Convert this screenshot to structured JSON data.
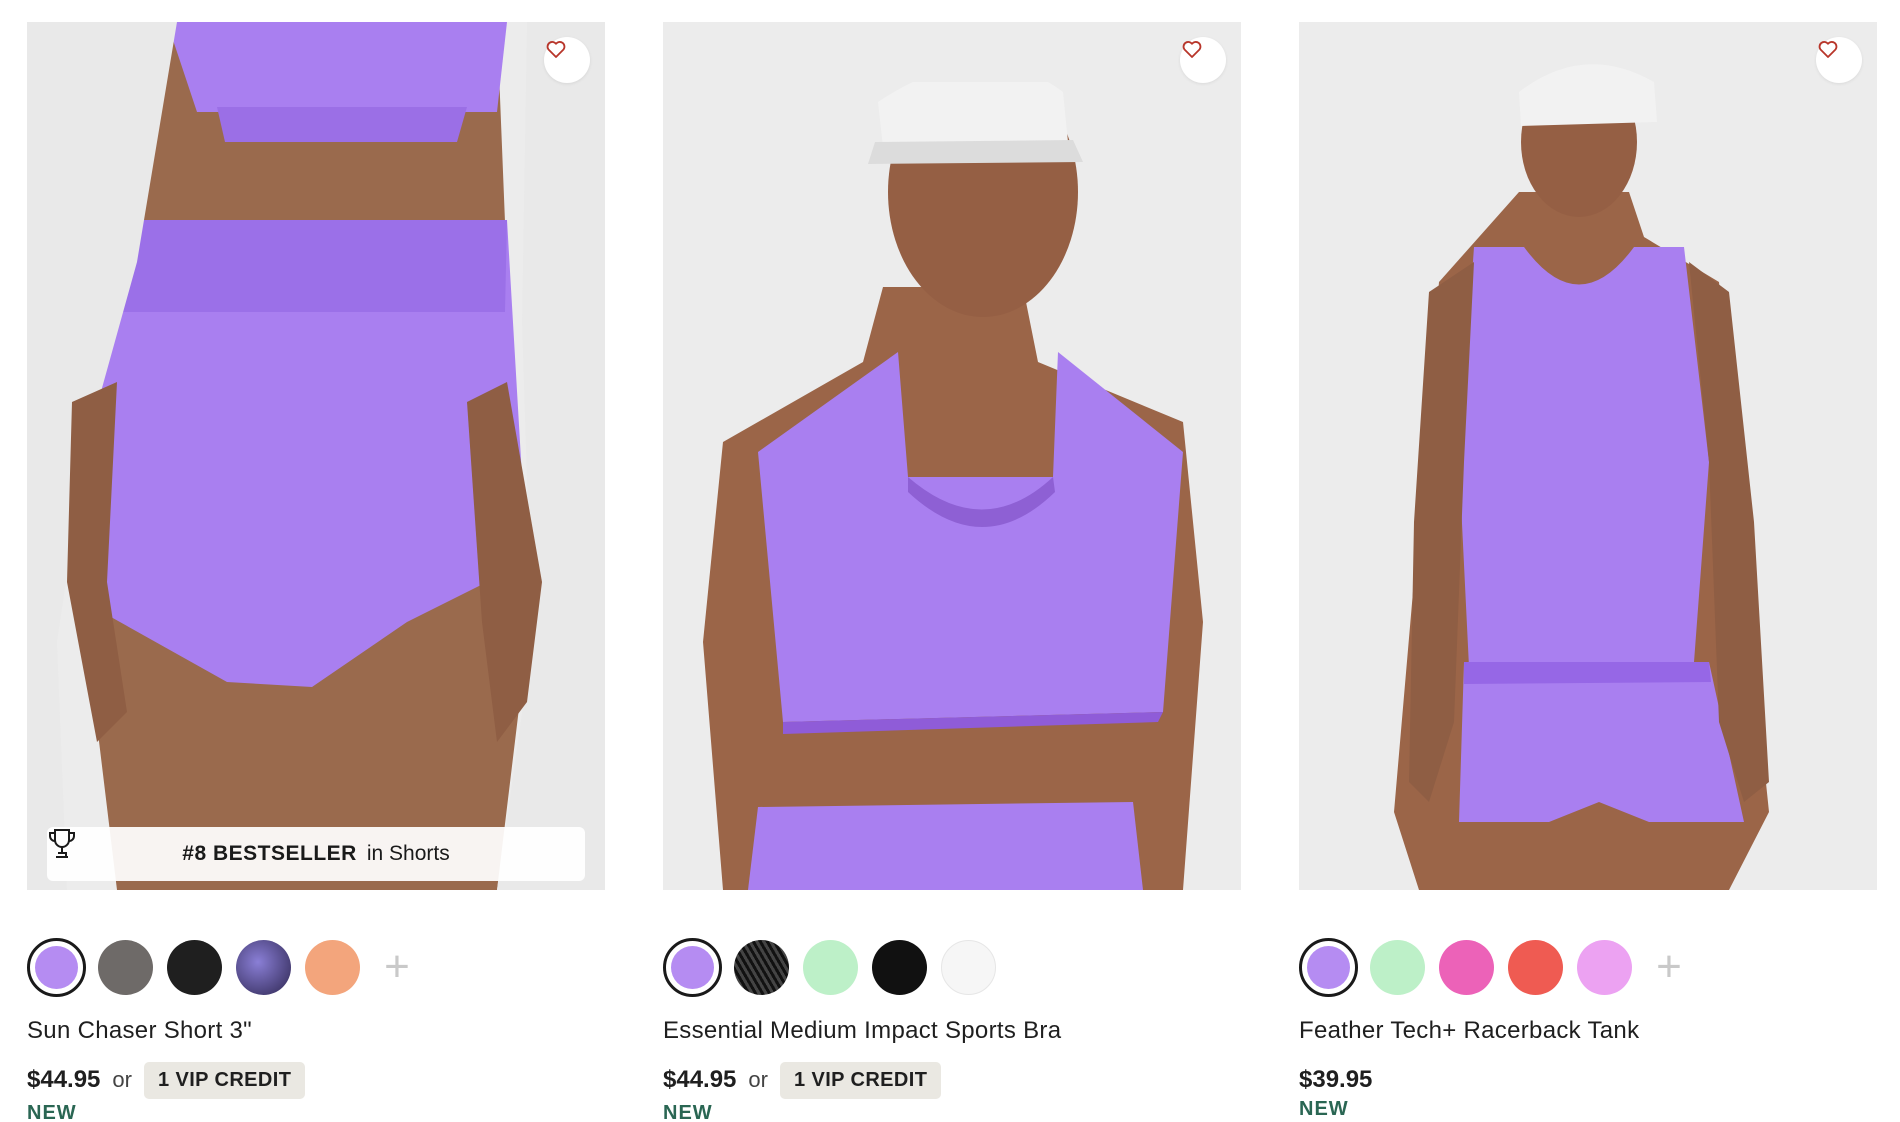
{
  "products": [
    {
      "name": "Sun Chaser Short 3\"",
      "price": "$44.95",
      "or_text": "or",
      "credit_label": "1 VIP CREDIT",
      "new_label": "NEW",
      "badge": {
        "rank": "#8 BESTSELLER",
        "suffix": "in Shorts"
      },
      "swatches": [
        {
          "color": "#b58cf2",
          "selected": true
        },
        {
          "color": "#6e6a68"
        },
        {
          "color": "#1f1f1f"
        },
        {
          "color": "#4a3f72"
        },
        {
          "color": "#f3a57c"
        }
      ],
      "more_label": "+"
    },
    {
      "name": "Essential Medium Impact Sports Bra",
      "price": "$44.95",
      "or_text": "or",
      "credit_label": "1 VIP CREDIT",
      "new_label": "NEW",
      "swatches": [
        {
          "color": "#b58cf2",
          "selected": true
        },
        {
          "color": "#2a2a2a"
        },
        {
          "color": "#bdf0c8"
        },
        {
          "color": "#111111"
        },
        {
          "color": "#f6f6f6"
        }
      ]
    },
    {
      "name": "Feather Tech+ Racerback Tank",
      "price": "$39.95",
      "new_label": "NEW",
      "swatches": [
        {
          "color": "#b58cf2",
          "selected": true
        },
        {
          "color": "#bdf0c8"
        },
        {
          "color": "#ec62b8"
        },
        {
          "color": "#ef5b52"
        },
        {
          "color": "#eca2f2"
        }
      ],
      "more_label": "+"
    }
  ],
  "colors": {
    "accent_purple": "#a97ff0",
    "new_label": "#2a6653",
    "heart": "#b8352a",
    "credit_bg": "#eae8e2",
    "photo_bg": "#ececec"
  },
  "icons": {
    "favorite": "heart-outline-icon",
    "badge": "trophy-icon",
    "more": "plus-icon"
  }
}
